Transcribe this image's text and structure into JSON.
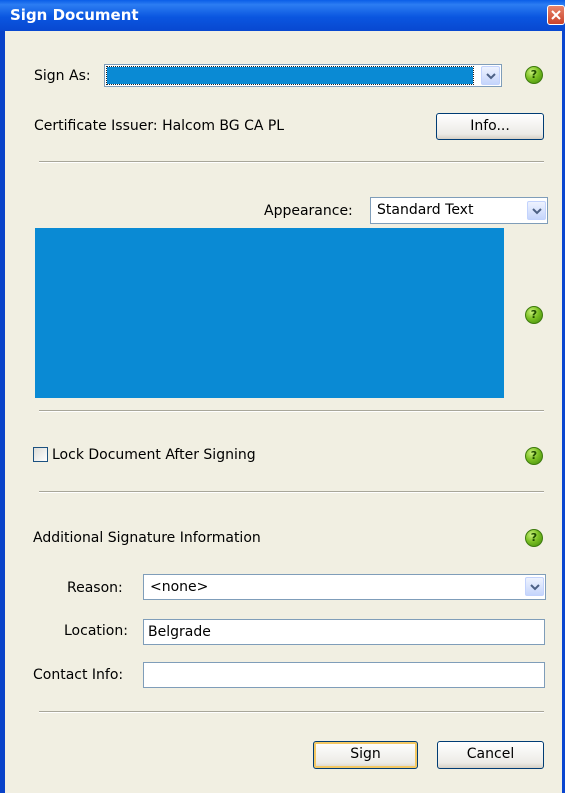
{
  "window": {
    "title": "Sign Document"
  },
  "sign_as": {
    "label": "Sign As:",
    "value": ""
  },
  "certificate": {
    "label": "Certificate Issuer:",
    "issuer": "Halcom BG CA PL",
    "info_button": "Info..."
  },
  "appearance": {
    "label": "Appearance:",
    "value": "Standard Text"
  },
  "lock": {
    "label": "Lock Document After Signing",
    "checked": false
  },
  "additional": {
    "heading": "Additional Signature Information",
    "reason_label": "Reason:",
    "reason_value": "<none>",
    "location_label": "Location:",
    "location_value": "Belgrade",
    "contact_label": "Contact Info:",
    "contact_value": ""
  },
  "buttons": {
    "sign": "Sign",
    "cancel": "Cancel"
  },
  "help_icon_glyph": "?",
  "colors": {
    "title_bar": "#0a56e0",
    "selection": "#0a8ad4",
    "help_icon": "#7cc024"
  }
}
